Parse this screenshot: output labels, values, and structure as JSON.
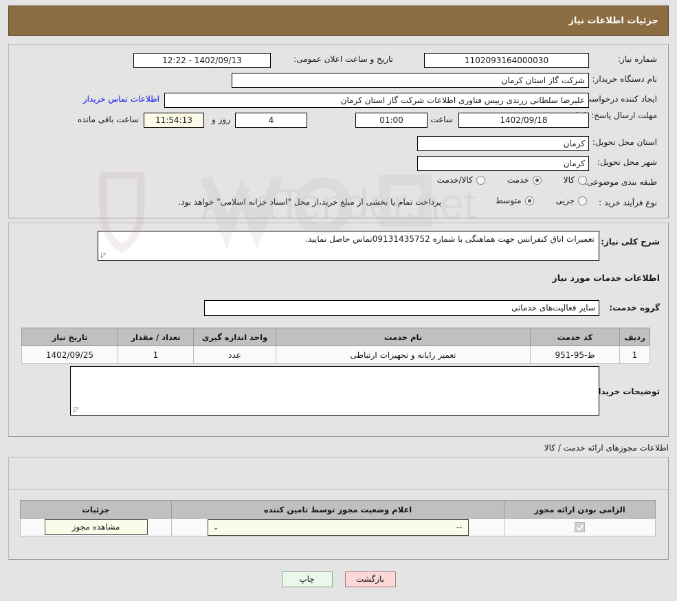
{
  "header": {
    "title": "جزئیات اطلاعات نیاز"
  },
  "info": {
    "need_number_label": "شماره نیاز:",
    "need_number_value": "1102093164000030",
    "public_announce_label": "تاریخ و ساعت اعلان عمومی:",
    "public_announce_value": "1402/09/13 - 12:22",
    "buyer_org_label": "نام دستگاه خریدار:",
    "buyer_org_value": "شرکت گاز استان کرمان",
    "requester_label": "ایجاد کننده درخواست:",
    "requester_value": "علیرضا سلطانی زرندی رییس فناوری اطلاعات شرکت گاز استان کرمان",
    "contact_link": "اطلاعات تماس خریدار",
    "deadline_label": "مهلت ارسال پاسخ: تا تاریخ:",
    "deadline_date": "1402/09/18",
    "hour_label": "ساعت",
    "deadline_time": "01:00",
    "days_value": "4",
    "days_label": "روز و",
    "countdown_value": "11:54:13",
    "countdown_label": "ساعت باقی مانده",
    "province_label": "استان محل تحویل:",
    "province_value": "کرمان",
    "city_label": "شهر محل تحویل:",
    "city_value": "کرمان",
    "classification_label": "طبقه بندی موضوعی:",
    "classification_options": [
      {
        "label": "کالا",
        "selected": false
      },
      {
        "label": "خدمت",
        "selected": true
      },
      {
        "label": "کالا/خدمت",
        "selected": false
      }
    ],
    "process_type_label": "نوع فرآیند خرید :",
    "process_type_options": [
      {
        "label": "جزیی",
        "selected": false
      },
      {
        "label": "متوسط",
        "selected": true
      }
    ],
    "payment_note": "پرداخت تمام یا بخشی از مبلغ خرید،از محل \"اسناد خزانه اسلامی\" خواهد بود."
  },
  "description": {
    "general_label": "شرح کلی نیاز:",
    "general_value": "تعمیرات اتاق کنفرانس جهت هماهنگی با شماره 09131435752تماس حاصل نمایید.",
    "services_head": "اطلاعات خدمات مورد نیاز",
    "service_group_label": "گروه خدمت:",
    "service_group_value": "سایر فعالیت‌های خدماتی",
    "buyer_notes_label": "توضیحات خریدار;",
    "buyer_notes_value": ""
  },
  "items_table": {
    "columns": [
      "ردیف",
      "کد خدمت",
      "نام خدمت",
      "واحد اندازه گیری",
      "تعداد / مقدار",
      "تاریخ نیاز"
    ],
    "rows": [
      {
        "row": "1",
        "code": "ط-95-951",
        "name": "تعمیر رایانه و تجهیزات ارتباطی",
        "unit": "عدد",
        "qty": "1",
        "date": "1402/09/25"
      }
    ]
  },
  "license": {
    "section_label": "اطلاعات مجوزهای ارائه خدمت / کالا",
    "columns": [
      "الزامی بودن ارائه مجوز",
      "اعلام وضعیت مجوز توسط تامین کننده",
      "جزئیات"
    ],
    "rows": [
      {
        "required_checked": true,
        "status_value": "--",
        "details_button": "مشاهده مجوز"
      }
    ]
  },
  "footer": {
    "print_label": "چاپ",
    "back_label": "بازگشت"
  },
  "watermark": {
    "text": "AriaTender.net"
  },
  "colors": {
    "header_bar": "#8c6d41",
    "page_bg": "#e4e4e4",
    "link": "#1414ee",
    "print_btn": "#eaf7ea",
    "back_btn": "#fbd8d8",
    "highlight_field": "#fbfbe8"
  }
}
